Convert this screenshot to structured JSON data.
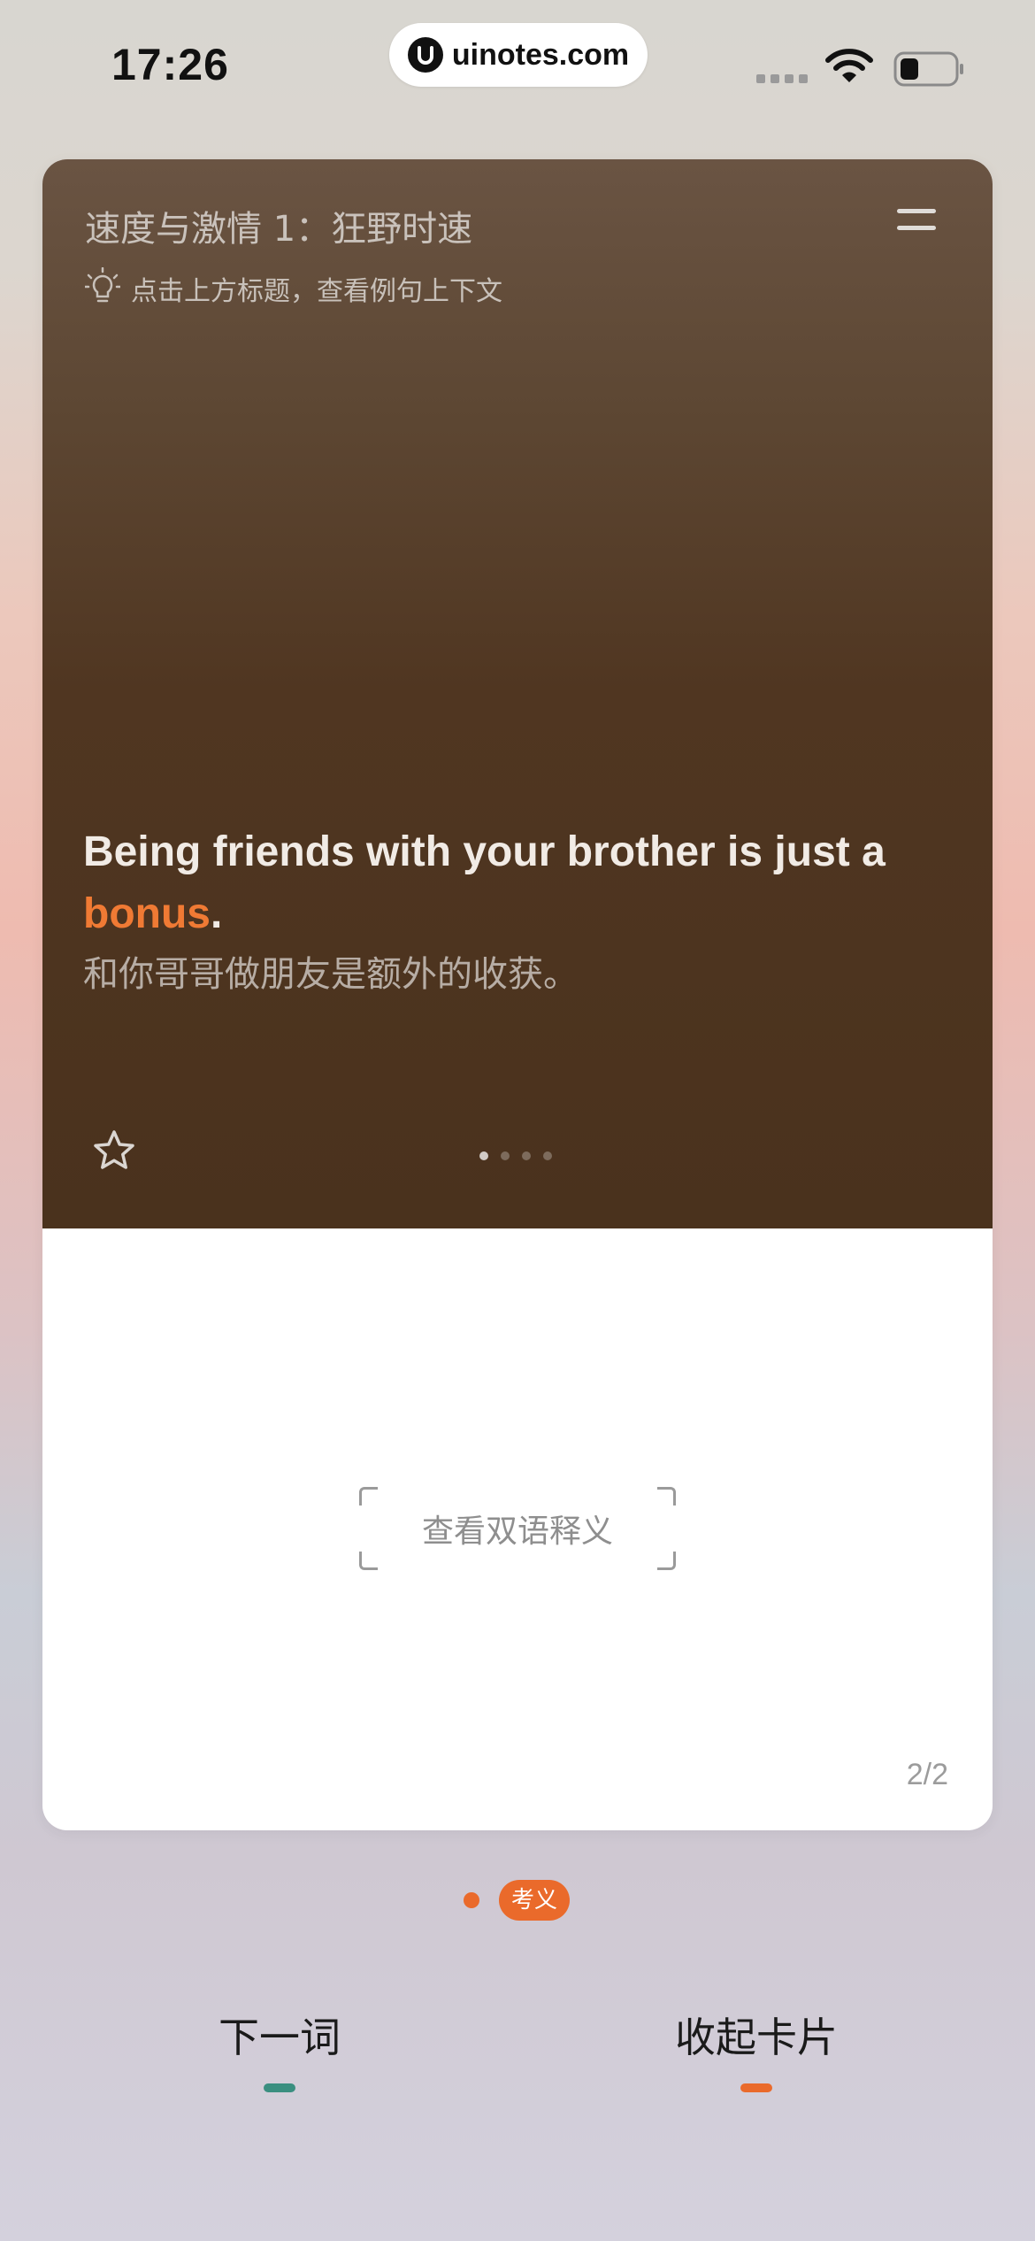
{
  "status_bar": {
    "time": "17:26",
    "watermark": "uinotes.com"
  },
  "card": {
    "title": "速度与激情 1：狂野时速",
    "tip": "点击上方标题，查看例句上下文",
    "sentence": {
      "before": "Being friends with your brother is just a ",
      "keyword": "bonus",
      "after": ".",
      "translation": "和你哥哥做朋友是额外的收获。"
    },
    "pagination": {
      "count": 4,
      "active": 0
    },
    "reveal_label": "查看双语释义",
    "page_indicator": "2/2"
  },
  "meaning_tab": {
    "badge": "考义"
  },
  "bottom_bar": {
    "next_word": "下一词",
    "collapse_card": "收起卡片"
  },
  "colors": {
    "accent": "#ea6a2b",
    "keyword": "#f07a34",
    "card_top": "#4a321d",
    "next_indicator": "#3a8f80"
  },
  "icons": [
    "menu-icon",
    "lightbulb-icon",
    "star-icon",
    "wifi-icon",
    "battery-icon",
    "signal-icon"
  ]
}
